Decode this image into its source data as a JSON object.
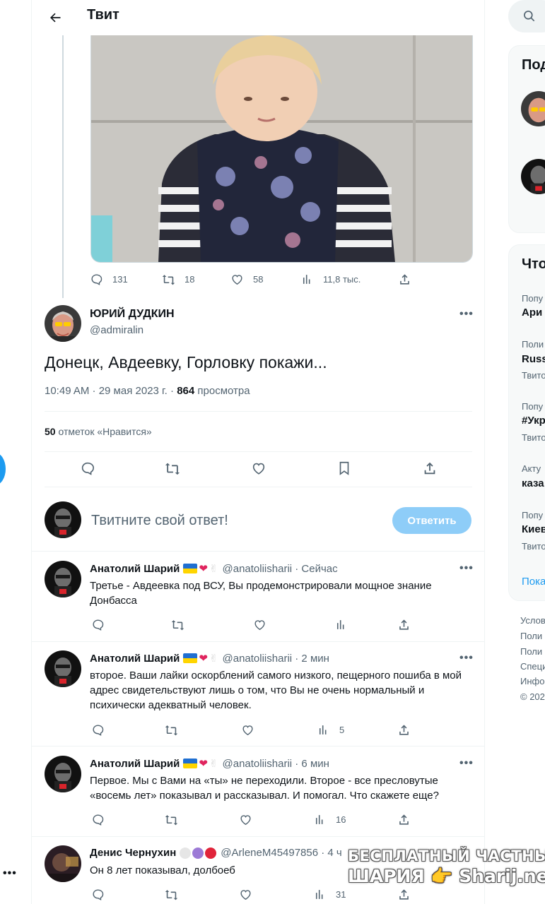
{
  "header": {
    "title": "Твит"
  },
  "parent_stats": {
    "replies": "131",
    "retweets": "18",
    "likes": "58",
    "views": "11,8 тыс."
  },
  "tweet": {
    "author_name": "ЮРИЙ ДУДКИН",
    "author_handle": "@admiralin",
    "text": "Донецк, Авдеевку, Горловку покажи...",
    "time": "10:49 AM · 29 мая 2023 г. · ",
    "views_count": "864",
    "views_label": " просмотра",
    "likes_count": "50",
    "likes_label": " отметок «Нравится»"
  },
  "composer": {
    "placeholder": "Твитните свой ответ!",
    "button": "Ответить"
  },
  "replies": [
    {
      "name": "Анатолий Шарий",
      "handle": "@anatoliisharii · Сейчас",
      "text": "Третье - Авдеевка под ВСУ, Вы продемонстрировали мощное знание Донбасса",
      "views": ""
    },
    {
      "name": "Анатолий Шарий",
      "handle": "@anatoliisharii · 2 мин",
      "text": "второе. Ваши лайки оскорблений самого низкого, пещерного пошиба в мой адрес свидетельствуют лишь о том, что Вы не очень нормальный и психически адекватный человек.",
      "views": "5"
    },
    {
      "name": "Анатолий Шарий",
      "handle": "@anatoliisharii · 6 мин",
      "text": "Первое. Мы с Вами на «ты» не переходили. Второе - все пресловутые «восемь лет» показывал и рассказывал. И помогал. Что скажете еще?",
      "views": "16"
    },
    {
      "name": "Денис Чернухин",
      "handle": "@ArleneM45497856 · 4 ч",
      "text": "Он 8 лет показывал, долбоеб",
      "views": "31"
    }
  ],
  "sidebar": {
    "who_to_follow_title": "Под",
    "trends_title": "Что",
    "trends": [
      {
        "context": "Попу",
        "name": "Ари",
        "count": ""
      },
      {
        "context": "Поли",
        "name": "Russ",
        "count": "Твито"
      },
      {
        "context": "Попу",
        "name": "#Укр",
        "count": "Твито"
      },
      {
        "context": "Акту",
        "name": "каза",
        "count": ""
      },
      {
        "context": "Попу",
        "name": "Киев",
        "count": "Твито"
      }
    ],
    "show_more": "Пока",
    "footer": [
      "Услов",
      "Поли",
      "Поли",
      "Специ",
      "Инфо",
      "© 202"
    ]
  },
  "watermark": {
    "line1": "БЕСПЛАТНЫЙ ЧАСТНЫЙ",
    "line2": "ШАРИЯ 👉 Sharij.net"
  },
  "colors": {
    "accent": "#1d9bf0",
    "reply_button": "#8ecdf8",
    "muted": "#536471"
  }
}
